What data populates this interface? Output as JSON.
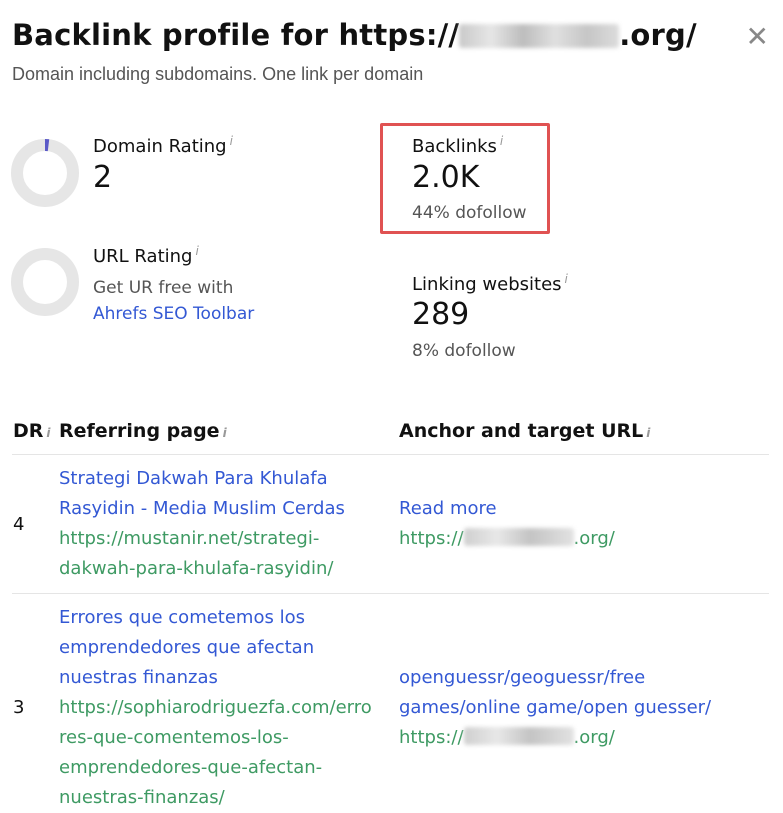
{
  "header": {
    "title_prefix": "Backlink profile for https://",
    "title_suffix": ".org/",
    "subtitle": "Domain including subdomains. One link per domain"
  },
  "metrics": {
    "domain_rating": {
      "label": "Domain Rating",
      "info": "i",
      "value": "2"
    },
    "url_rating": {
      "label": "URL Rating",
      "info": "i",
      "text": "Get UR free with",
      "link": "Ahrefs SEO Toolbar"
    },
    "backlinks": {
      "label": "Backlinks",
      "info": "i",
      "value": "2.0K",
      "sub": "44% dofollow"
    },
    "linking_websites": {
      "label": "Linking websites",
      "info": "i",
      "value": "289",
      "sub": "8% dofollow"
    }
  },
  "table": {
    "columns": [
      "DR",
      "Referring page",
      "Anchor and target URL"
    ],
    "info": "i",
    "rows": [
      {
        "dr": "4",
        "page_title_lines": [
          "Strategi Dakwah Para Khulafa",
          "Rasyidin - Media Muslim Cerdas"
        ],
        "page_url_lines": [
          "https://mustanir.net/strategi-",
          "dakwah-para-khulafa-rasyidin/"
        ],
        "anchor_lines": [
          "Read more"
        ],
        "target_prefix": "https://",
        "target_suffix": ".org/"
      },
      {
        "dr": "3",
        "page_title_lines": [
          "Errores que cometemos los",
          "emprendedores que afectan",
          "nuestras finanzas"
        ],
        "page_url_lines": [
          "https://sophiarodriguezfa.com/erro",
          "res-que-comentemos-los-",
          "emprendedores-que-afectan-",
          "nuestras-finanzas/"
        ],
        "anchor_lines": [
          "openguessr/geoguessr/free",
          "games/online game/open guesser/"
        ],
        "target_prefix": "https://",
        "target_suffix": ".org/"
      }
    ]
  }
}
